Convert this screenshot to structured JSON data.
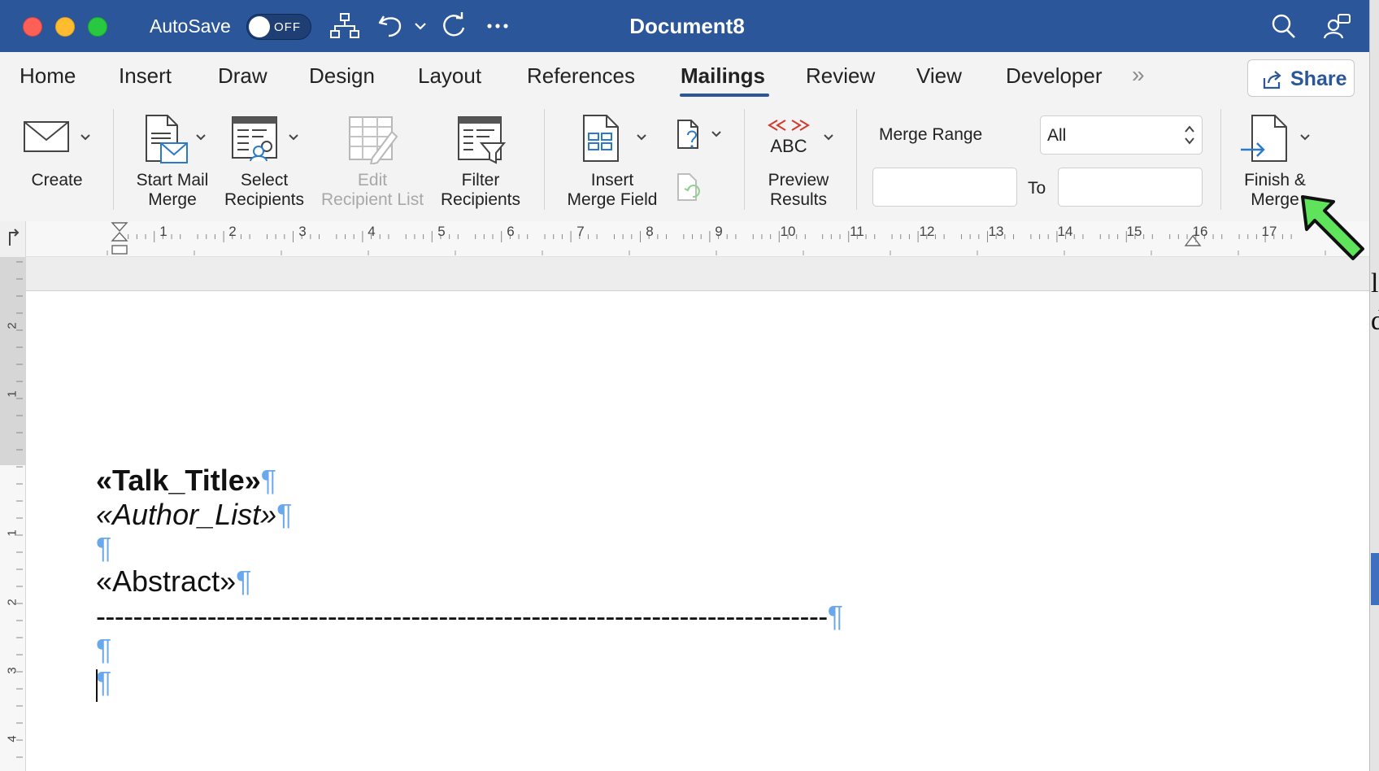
{
  "titlebar": {
    "autosave_label": "AutoSave",
    "autosave_state": "OFF",
    "document_title": "Document8",
    "icons": [
      "close-window",
      "minimize-window",
      "zoom-window",
      "switch-windows",
      "undo",
      "redo",
      "more",
      "search",
      "collaboration"
    ]
  },
  "tabs": {
    "items": [
      {
        "label": "Home"
      },
      {
        "label": "Insert"
      },
      {
        "label": "Draw"
      },
      {
        "label": "Design"
      },
      {
        "label": "Layout"
      },
      {
        "label": "References"
      },
      {
        "label": "Mailings"
      },
      {
        "label": "Review"
      },
      {
        "label": "View"
      },
      {
        "label": "Developer"
      }
    ],
    "active": "Mailings",
    "more_label": "»",
    "share_label": "Share"
  },
  "ribbon": {
    "create": {
      "label": "Create"
    },
    "start_mail_merge": {
      "line1": "Start Mail",
      "line2": "Merge"
    },
    "select_recipients": {
      "line1": "Select",
      "line2": "Recipients"
    },
    "edit_recipient_list": {
      "line1": "Edit",
      "line2": "Recipient List"
    },
    "filter_recipients": {
      "line1": "Filter",
      "line2": "Recipients"
    },
    "insert_merge_field": {
      "line1": "Insert",
      "line2": "Merge Field"
    },
    "preview_results": {
      "line1": "Preview",
      "line2": "Results",
      "icon_text": "ABC"
    },
    "merge_range": {
      "label": "Merge Range",
      "value": "All",
      "from_value": "",
      "to_label": "To",
      "to_value": ""
    },
    "finish_merge": {
      "line1": "Finish &",
      "line2": "Merge"
    }
  },
  "ruler": {
    "numbers": [
      "1",
      "2",
      "3",
      "4",
      "5",
      "6",
      "7",
      "8",
      "9",
      "10",
      "11",
      "12",
      "13",
      "14",
      "15",
      "16",
      "17"
    ],
    "vertical_numbers": [
      "2",
      "1",
      "1",
      "2",
      "3",
      "4"
    ]
  },
  "document": {
    "line_title": "«Talk_Title»",
    "line_author": "«Author_List»",
    "line_abstract": "«Abstract»",
    "line_dashes": "-------------------------------------------------------------------------------",
    "pilcrow": "¶"
  },
  "right_edge_chars": [
    "l",
    "d"
  ],
  "colors": {
    "titlebar": "#2b579a",
    "ribbon": "#f3f3f3",
    "pilcrow": "#6aa8ee",
    "annotation_arrow": "#5ee35a"
  }
}
